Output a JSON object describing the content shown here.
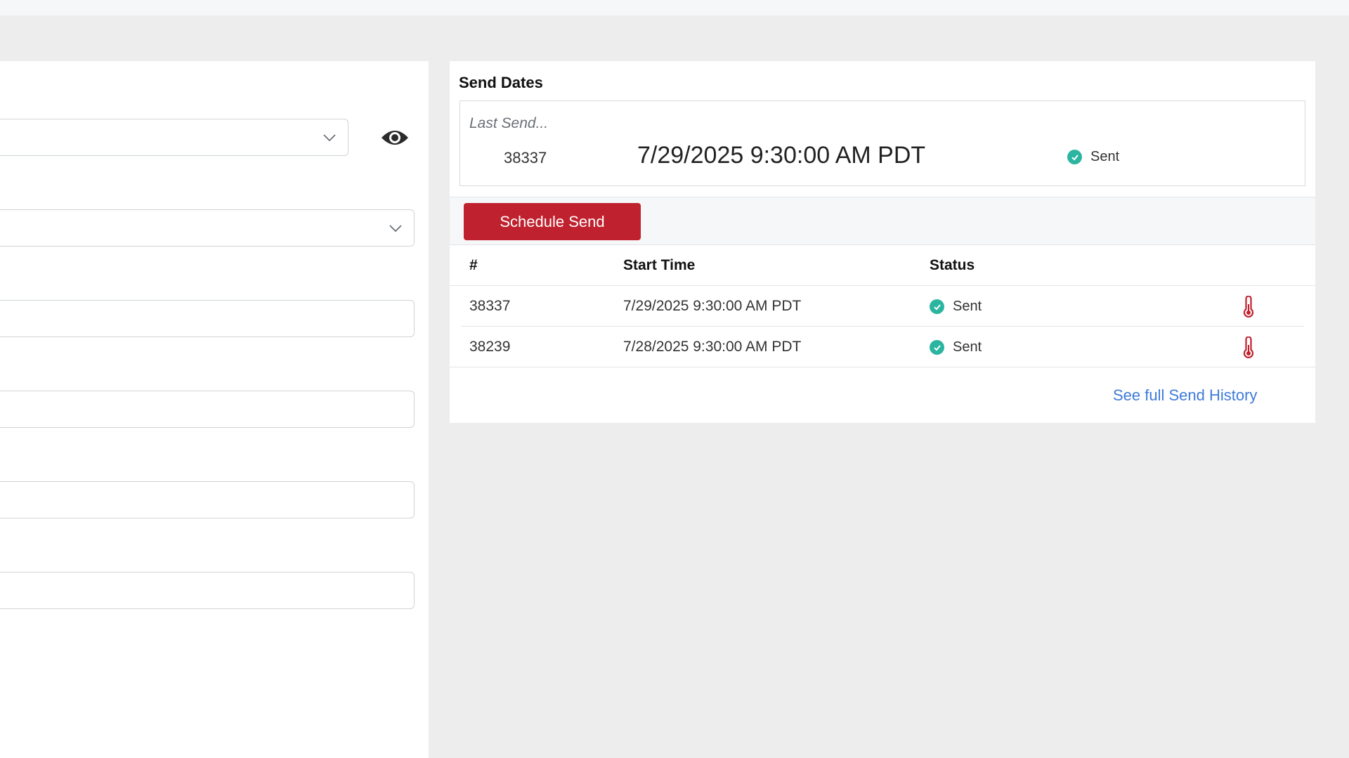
{
  "send_dates": {
    "title": "Send Dates",
    "last_send": {
      "label": "Last Send...",
      "id": "38337",
      "time": "7/29/2025 9:30:00 AM PDT",
      "status": "Sent"
    },
    "schedule_button": "Schedule Send",
    "columns": [
      "#",
      "Start Time",
      "Status"
    ],
    "rows": [
      {
        "id": "38337",
        "start_time": "7/29/2025 9:30:00 AM PDT",
        "status": "Sent"
      },
      {
        "id": "38239",
        "start_time": "7/28/2025 9:30:00 AM PDT",
        "status": "Sent"
      }
    ],
    "history_link": "See full Send History"
  },
  "colors": {
    "accent_red": "#c0212e",
    "status_green": "#2bb5a0",
    "link_blue": "#3f7bd9"
  },
  "icons": {
    "preview": "eye-icon",
    "dropdown": "chevron-down-icon",
    "status_sent": "check-circle-icon",
    "row_action": "thermometer-icon"
  }
}
